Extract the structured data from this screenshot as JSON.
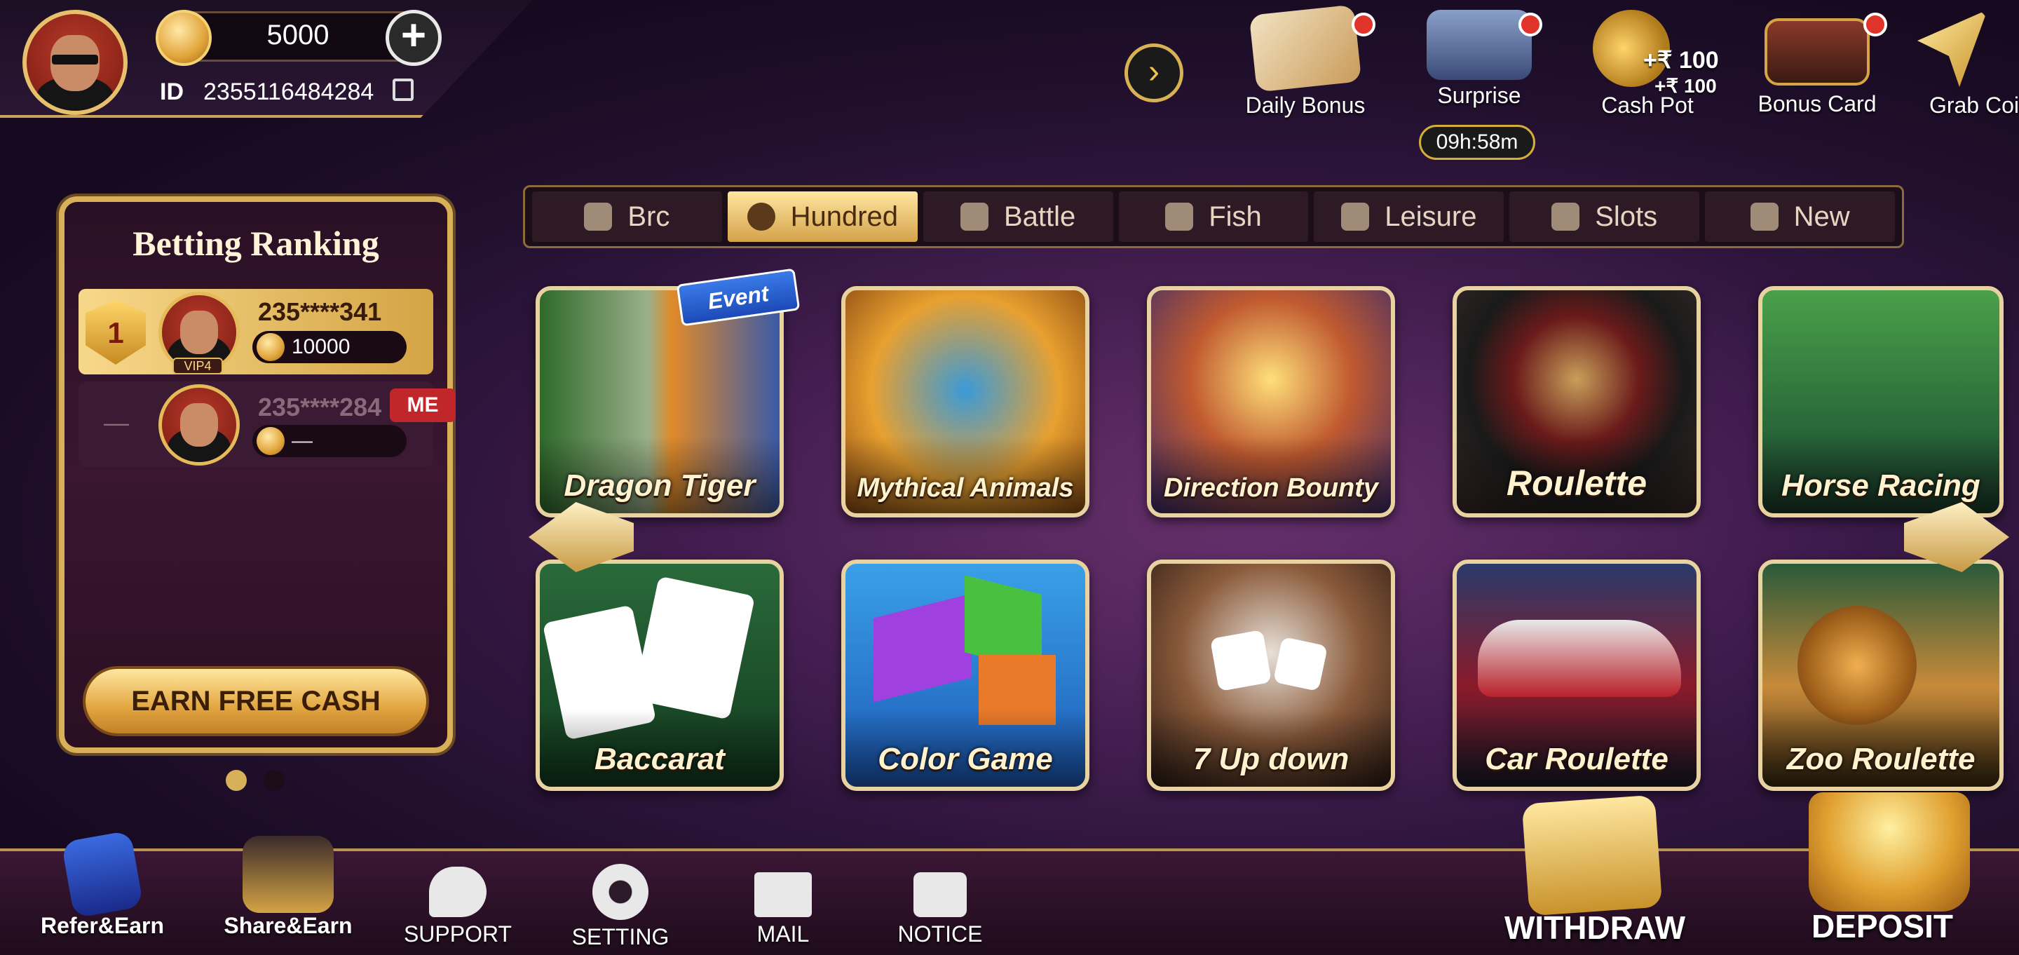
{
  "profile": {
    "coins": "5000",
    "id_label": "ID",
    "id_value": "2355116484284"
  },
  "top_menu": [
    {
      "label": "Daily Bonus"
    },
    {
      "label": "Surprise",
      "timer": "09h:58m"
    },
    {
      "label": "Cash Pot",
      "amount_1": "+₹ 100",
      "amount_2": "+₹ 100"
    },
    {
      "label": "Bonus Card"
    },
    {
      "label": "Grab Coi"
    }
  ],
  "tabs": [
    {
      "label": "Brc",
      "icon": "fire-icon"
    },
    {
      "label": "Hundred",
      "icon": "people-icon",
      "active": true
    },
    {
      "label": "Battle",
      "icon": "swords-icon"
    },
    {
      "label": "Fish",
      "icon": "fishing-icon"
    },
    {
      "label": "Leisure",
      "icon": "video-icon"
    },
    {
      "label": "Slots",
      "icon": "slot-machine-icon"
    },
    {
      "label": "New",
      "icon": "video-icon"
    }
  ],
  "ranking": {
    "title": "Betting Ranking",
    "rows": [
      {
        "rank": "1",
        "name": "235****341",
        "vip": "VIP4",
        "amount": "10000"
      },
      {
        "rank": "—",
        "name": "235****284",
        "badge": "ME",
        "amount": "—"
      }
    ],
    "earn_button": "EARN FREE CASH"
  },
  "games": [
    {
      "label": "Dragon Tiger",
      "badge": "Event"
    },
    {
      "label": "Mythical Animals"
    },
    {
      "label": "Direction Bounty"
    },
    {
      "label": "Roulette"
    },
    {
      "label": "Horse Racing"
    },
    {
      "label": "Baccarat"
    },
    {
      "label": "Color Game"
    },
    {
      "label": "7 Up down"
    },
    {
      "label": "Car Roulette"
    },
    {
      "label": "Zoo Roulette"
    }
  ],
  "bottom": {
    "refer": "Refer&Earn",
    "share": "Share&Earn",
    "support": "SUPPORT",
    "setting": "SETTING",
    "mail": "MAIL",
    "notice": "NOTICE",
    "withdraw": "WITHDRAW",
    "deposit": "DEPOSIT"
  },
  "colors": {
    "accent_gold": "#d8b05a",
    "badge_red": "#c0262a",
    "background": "#3c1a4c"
  }
}
